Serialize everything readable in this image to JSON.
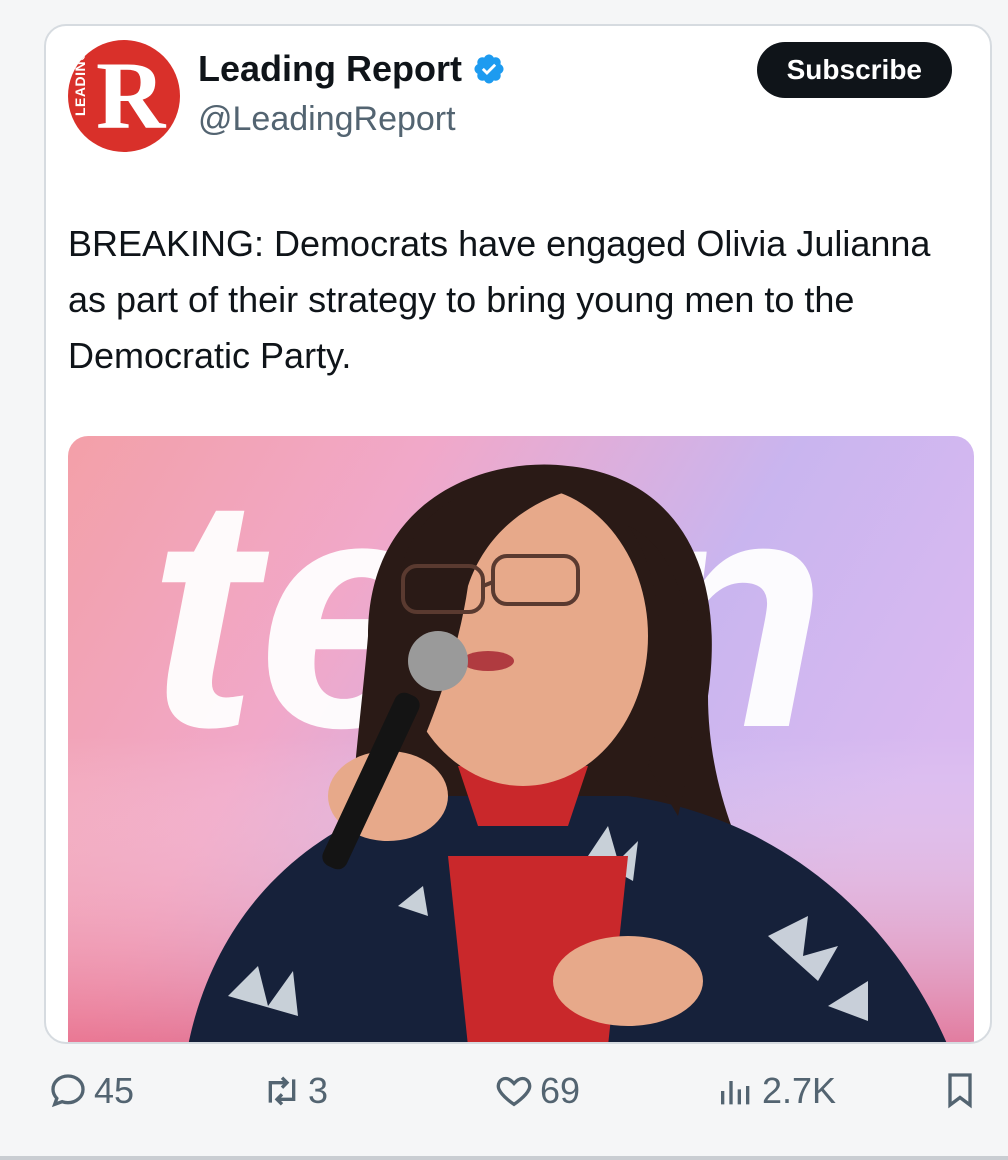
{
  "account": {
    "name": "Leading Report",
    "handle": "@LeadingReport",
    "avatar_letter": "R",
    "avatar_vertical_text": "LEADING",
    "brand_color": "#d9302a",
    "verified_color": "#1d9bf0"
  },
  "subscribe_label": "Subscribe",
  "tweet_text": "BREAKING: Democrats have engaged Olivia Julianna as part of their strategy to bring young men to the Democratic Party.",
  "media": {
    "sign_text": "teen"
  },
  "actions": {
    "replies": "45",
    "reposts": "3",
    "likes": "69",
    "views": "2.7K"
  }
}
